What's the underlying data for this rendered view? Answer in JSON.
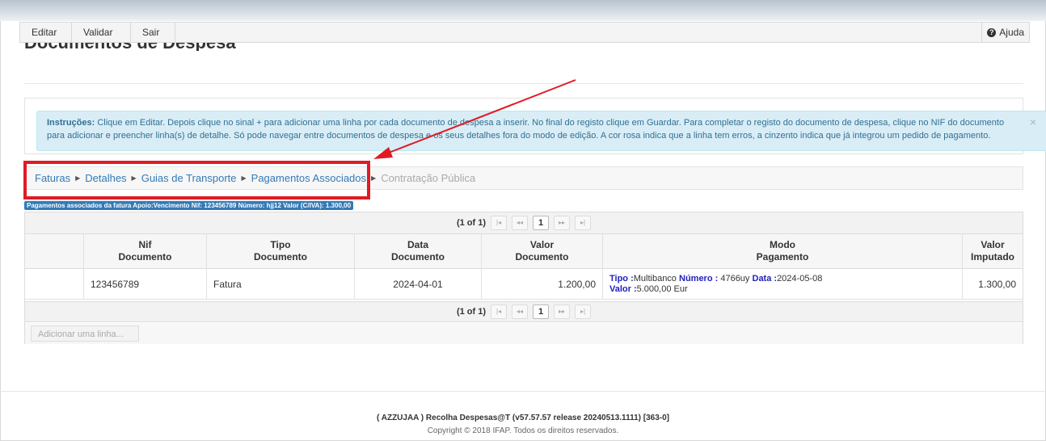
{
  "toolbar": {
    "edit": "Editar",
    "validate": "Validar",
    "exit": "Sair",
    "help": "Ajuda"
  },
  "page": {
    "title": "Documentos de Despesa"
  },
  "instructions": {
    "label": "Instruções:",
    "text": " Clique em Editar. Depois clique no sinal + para adicionar uma linha por cada documento de despesa a inserir. No final do registo clique em Guardar. Para completar o registo do documento de despesa, clique no NIF do documento para adicionar e preencher linha(s) de detalhe. Só pode navegar entre documentos de despesa e os seus detalhes fora do modo de edição. A cor rosa indica que a linha tem erros, a cinzento indica que já integrou um pedido de pagamento.",
    "close": "×"
  },
  "breadcrumbs": [
    {
      "label": "Faturas"
    },
    {
      "label": "Detalhes"
    },
    {
      "label": "Guias de Transporte"
    },
    {
      "label": "Pagamentos Associados"
    },
    {
      "label": "Contratação Pública"
    }
  ],
  "caption": "Pagamentos associados da fatura   Apoio:Vencimento   Nif: 123456789   Número: hjj12   Valor (C/IVA): 1.300,00",
  "pager": {
    "info": "(1 of 1)",
    "first": "|◂",
    "prev": "◂◂",
    "page": "1",
    "next": "▸▸",
    "last": "▸|"
  },
  "table": {
    "headers": [
      {
        "line1": "",
        "line2": ""
      },
      {
        "line1": "Nif",
        "line2": "Documento"
      },
      {
        "line1": "Tipo",
        "line2": "Documento"
      },
      {
        "line1": "Data",
        "line2": "Documento"
      },
      {
        "line1": "Valor",
        "line2": "Documento"
      },
      {
        "line1": "Modo",
        "line2": "Pagamento"
      },
      {
        "line1": "Valor",
        "line2": "Imputado"
      }
    ],
    "rows": [
      {
        "nif": "123456789",
        "tipo": "Fatura",
        "data": "2024-04-01",
        "valor": "1.200,00",
        "modo": {
          "tipo_label": "Tipo :",
          "tipo": "Multibanco",
          "numero_label": "Número :",
          "numero": " 4766uy",
          "data_label": "Data :",
          "data": "2024-05-08",
          "valor_label": "Valor :",
          "valor": "5.000,00 Eur"
        },
        "imputado": "1.300,00"
      }
    ]
  },
  "add_row": "Adicionar uma linha...",
  "footer": {
    "line1": "( AZZUJAA ) Recolha Despesas@T (v57.57.57 release 20240513.1111) [363-0]",
    "line2": "Copyright © 2018 IFAP. Todos os direitos reservados."
  },
  "colors": {
    "highlight": "#e01b24",
    "link": "#337ab7",
    "alert_bg": "#d9edf7"
  }
}
